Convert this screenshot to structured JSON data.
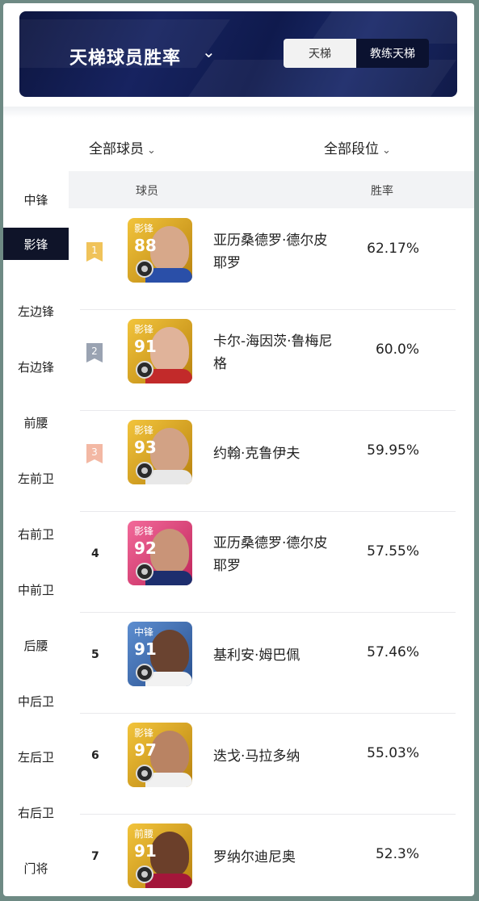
{
  "header": {
    "title": "天梯球员胜率",
    "tabs": [
      {
        "label": "天梯",
        "active": true
      },
      {
        "label": "教练天梯",
        "active": false
      }
    ]
  },
  "filters": {
    "players": "全部球员",
    "tiers": "全部段位"
  },
  "sidebar": {
    "items": [
      "中锋",
      "影锋",
      "左边锋",
      "右边锋",
      "前腰",
      "左前卫",
      "右前卫",
      "中前卫",
      "后腰",
      "中后卫",
      "左后卫",
      "右后卫",
      "门将"
    ],
    "active_index": 1
  },
  "table": {
    "headers": {
      "player": "球员",
      "winrate": "胜率"
    },
    "rows": [
      {
        "rank": "1",
        "position": "影锋",
        "rating": "88",
        "name": "亚历桑德罗·德尔皮耶罗",
        "winrate": "62.17%",
        "card_color": "gold"
      },
      {
        "rank": "2",
        "position": "影锋",
        "rating": "91",
        "name": "卡尔-海因茨·鲁梅尼格",
        "winrate": "60.0%",
        "card_color": "gold"
      },
      {
        "rank": "3",
        "position": "影锋",
        "rating": "93",
        "name": "约翰·克鲁伊夫",
        "winrate": "59.95%",
        "card_color": "gold"
      },
      {
        "rank": "4",
        "position": "影锋",
        "rating": "92",
        "name": "亚历桑德罗·德尔皮耶罗",
        "winrate": "57.55%",
        "card_color": "pink"
      },
      {
        "rank": "5",
        "position": "中锋",
        "rating": "91",
        "name": "基利安·姆巴佩",
        "winrate": "57.46%",
        "card_color": "blue"
      },
      {
        "rank": "6",
        "position": "影锋",
        "rating": "97",
        "name": "迭戈·马拉多纳",
        "winrate": "55.03%",
        "card_color": "gold"
      },
      {
        "rank": "7",
        "position": "前腰",
        "rating": "91",
        "name": "罗纳尔迪尼奥",
        "winrate": "52.3%",
        "card_color": "gold"
      }
    ]
  },
  "colors": {
    "gold": "#d9a21c",
    "pink": "#e0457a",
    "blue": "#3d6fae",
    "badge1": "#f0c35a",
    "badge2": "#9aa3b2",
    "badge3": "#f3b8a4"
  }
}
